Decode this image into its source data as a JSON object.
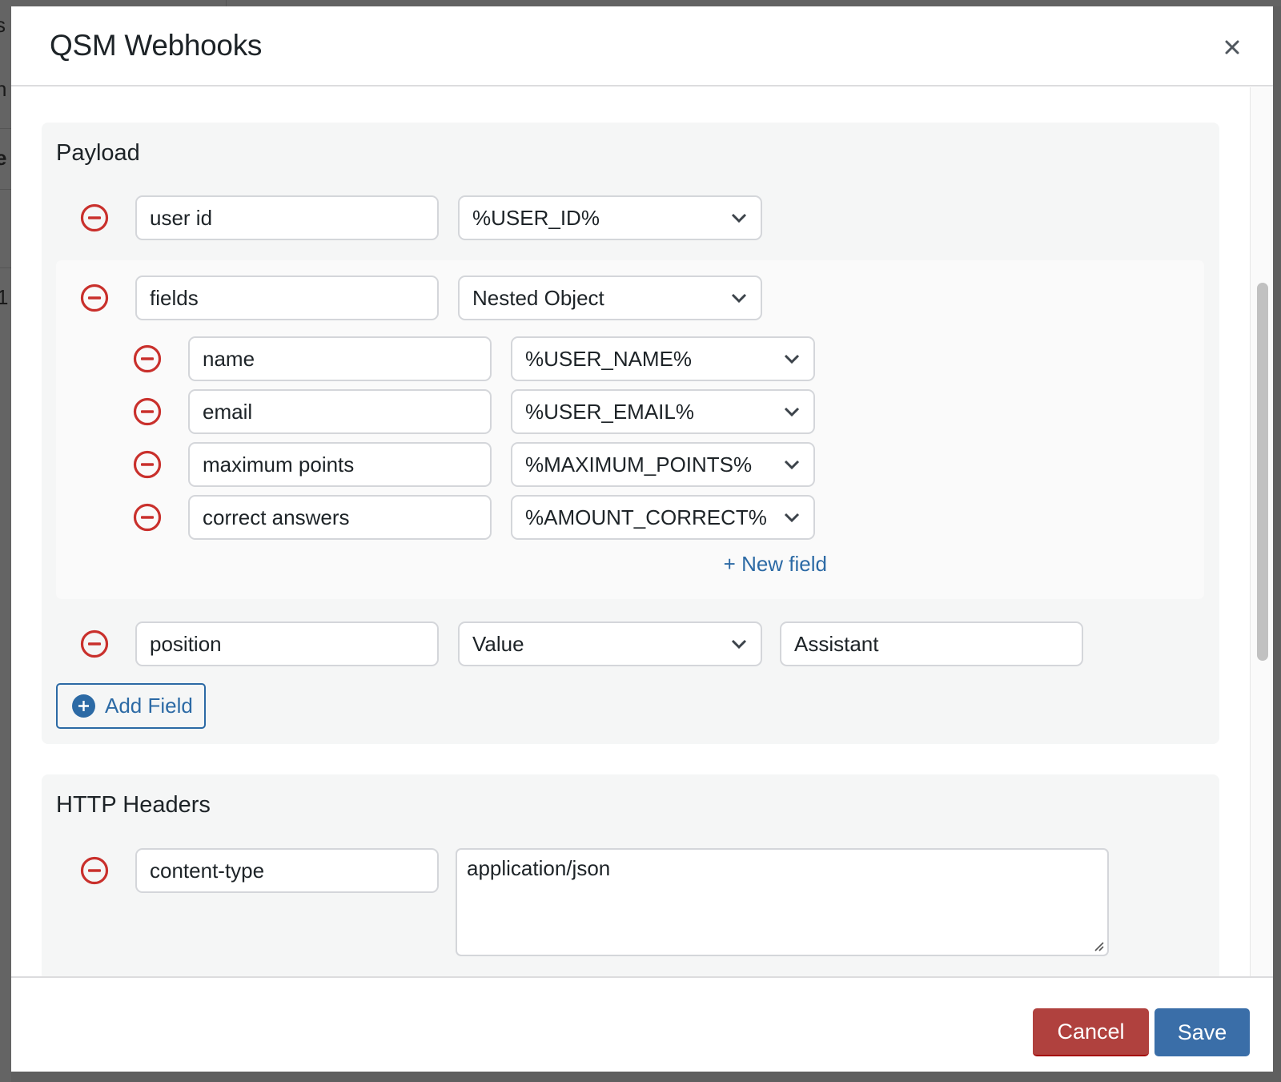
{
  "background": {
    "fragments": [
      "s",
      "n",
      "e",
      "1"
    ]
  },
  "modal": {
    "title": "QSM Webhooks",
    "close_icon": "close-icon"
  },
  "payload": {
    "title": "Payload",
    "rows": [
      {
        "key": "user id",
        "type": "%USER_ID%"
      },
      {
        "key": "fields",
        "type": "Nested Object",
        "children": [
          {
            "key": "name",
            "type": "%USER_NAME%"
          },
          {
            "key": "email",
            "type": "%USER_EMAIL%"
          },
          {
            "key": "maximum points",
            "type": "%MAXIMUM_POINTS%"
          },
          {
            "key": "correct answers",
            "type": "%AMOUNT_CORRECT%"
          }
        ],
        "new_field_label": "+ New field"
      },
      {
        "key": "position",
        "type": "Value",
        "value": "Assistant"
      }
    ],
    "add_field_label": "Add Field"
  },
  "http_headers": {
    "title": "HTTP Headers",
    "rows": [
      {
        "key": "content-type",
        "value": "application/json"
      }
    ]
  },
  "footer": {
    "cancel_label": "Cancel",
    "save_label": "Save"
  },
  "colors": {
    "remove": "#c9302c",
    "link": "#2c6aa5",
    "cancel": "#b0413e",
    "save": "#3a6ea8"
  }
}
